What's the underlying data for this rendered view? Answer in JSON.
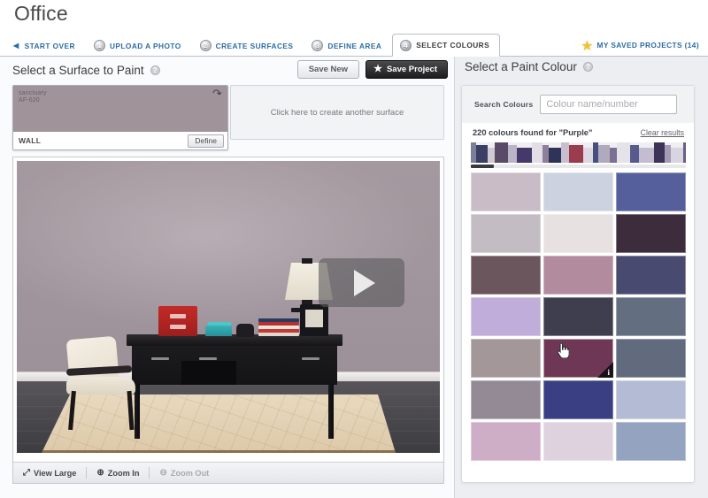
{
  "app": {
    "title": "Office"
  },
  "tabbar": {
    "back_label": "START OVER",
    "back_arrow": "◀",
    "tabs": [
      {
        "num": "1",
        "label": "UPLOAD A PHOTO",
        "active": false
      },
      {
        "num": "2",
        "label": "CREATE SURFACES",
        "active": false
      },
      {
        "num": "3",
        "label": "DEFINE AREA",
        "active": false
      },
      {
        "num": "4",
        "label": "SELECT COLOURS",
        "active": true
      }
    ],
    "saved_projects": "MY SAVED PROJECTS (14)",
    "star_icon": "★"
  },
  "left": {
    "title": "Select a Surface to Paint",
    "help_icon": "?",
    "save_new_label": "Save New",
    "save_project_label": "Save Project",
    "save_project_star": "★",
    "surface": {
      "colour_name": "sanctuary",
      "colour_code": "AF-620",
      "colour_hex": "#a1939a",
      "type_label": "WALL",
      "define_label": "Define",
      "undo_icon": "↶"
    },
    "create_surface_label": "Click here to create another surface",
    "toolbar": [
      {
        "icon": "⤢",
        "label": "View Large",
        "disabled": false
      },
      {
        "icon": "⊕",
        "label": "Zoom In",
        "disabled": false
      },
      {
        "icon": "⊖",
        "label": "Zoom Out",
        "disabled": true
      }
    ],
    "play_button_label": "Play"
  },
  "right": {
    "title": "Select a Paint Colour",
    "help_icon": "?",
    "search_label": "Search Colours",
    "search_value": "",
    "search_placeholder": "Colour name/number",
    "results_text": "220 colours found for \"Purple\"",
    "clear_results_label": "Clear results",
    "info_icon": "i",
    "hovered_index": 13,
    "swatches": [
      "#c9bcc7",
      "#ccd2e0",
      "#555f9c",
      "#c3bcc3",
      "#e8e1e2",
      "#3c2c3c",
      "#6a565c",
      "#b38b9e",
      "#494a70",
      "#c0add9",
      "#3f3e4e",
      "#646e81",
      "#a3979a",
      "#6f3756",
      "#616b7d",
      "#938a96",
      "#3a3f83",
      "#b4bcd5",
      "#ceaec6",
      "#ddd2de",
      "#93a3c0"
    ],
    "navstrip_colours": [
      "#7d7f99",
      "#3b3f66",
      "#cfc9d2",
      "#5a4a68",
      "#b9b4c6",
      "#45396b",
      "#e3dee6",
      "#8e7f9b",
      "#2f3358",
      "#c7bfd0",
      "#9a3b4e",
      "#dcd7e0",
      "#4a4e7e",
      "#b0aabf",
      "#7c6f92",
      "#e6e2ea",
      "#565a8c",
      "#c4bdd1",
      "#3d3258",
      "#a59cb4",
      "#d9d4e2",
      "#6b5f86",
      "#8f8aa8",
      "#efecf2"
    ]
  }
}
